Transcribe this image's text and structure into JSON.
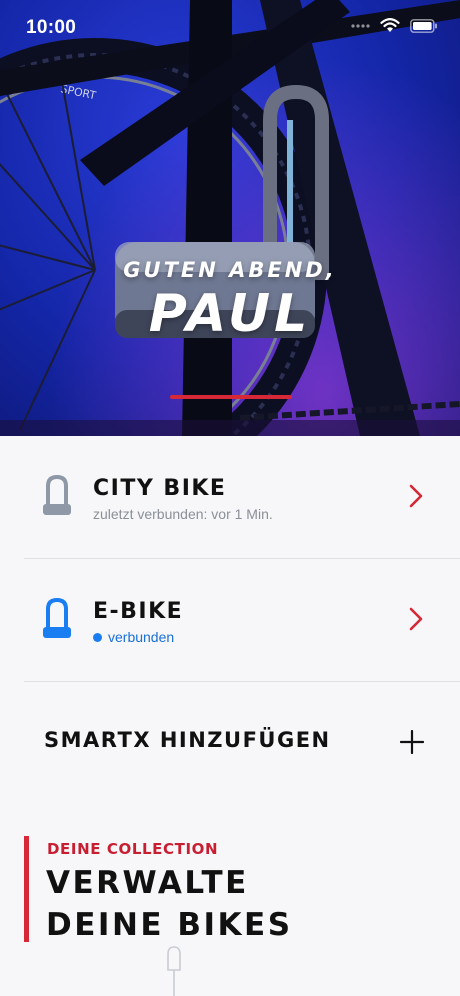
{
  "status_bar": {
    "time": "10:00"
  },
  "hero": {
    "greeting": "GUTEN ABEND,",
    "name": "PAUL",
    "tire_text": "SPORT"
  },
  "devices": [
    {
      "name": "CITY BIKE",
      "status": "zuletzt verbunden: vor 1 Min.",
      "connected": false,
      "lock_color": "#8e98a6"
    },
    {
      "name": "E-BIKE",
      "status": "verbunden",
      "connected": true,
      "lock_color": "#1a7ef2"
    }
  ],
  "add_device": {
    "label": "SMARTX HINZUFÜGEN"
  },
  "collection": {
    "kicker": "DEINE COLLECTION",
    "headline_line1": "VERWALTE",
    "headline_line2": "DEINE BIKES"
  },
  "colors": {
    "accent": "#d62836",
    "connected": "#1a7ef2",
    "muted": "#8b8f97"
  },
  "icons": [
    "wifi-icon",
    "battery-icon",
    "signal-icon",
    "u-lock-icon",
    "chevron-right-icon",
    "plus-icon"
  ]
}
